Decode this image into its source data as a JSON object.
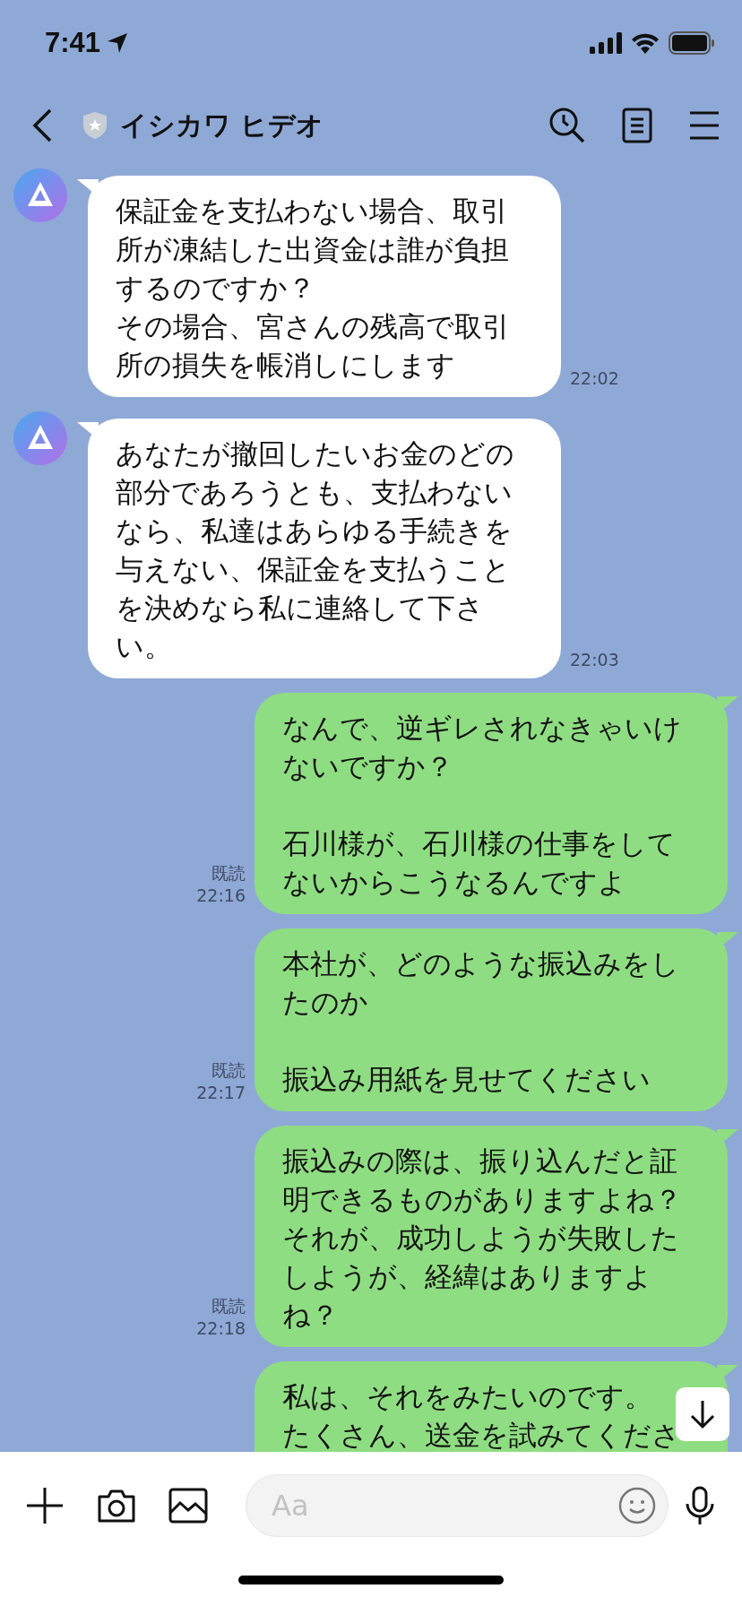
{
  "status_bar": {
    "time": "7:41"
  },
  "header": {
    "title": "イシカワ ヒデオ"
  },
  "messages": [
    {
      "kind": "incoming",
      "paragraphs": [
        {
          "text": "保証金を支払わない場合、取引所が凍結した出資金は誰が負担するのですか？",
          "gap_before": false
        },
        {
          "text": "その場合、宮さんの残高で取引所の損失を帳消しにします",
          "gap_before": false
        }
      ],
      "time": "22:02"
    },
    {
      "kind": "incoming",
      "paragraphs": [
        {
          "text": "あなたが撤回したいお金のどの部分であろうとも、支払わないなら、私達はあらゆる手続きを与えない、保証金を支払うことを決めなら私に連絡して下さい。",
          "gap_before": false
        }
      ],
      "time": "22:03"
    },
    {
      "kind": "outgoing",
      "paragraphs": [
        {
          "text": "なんで、逆ギレされなきゃいけないですか？",
          "gap_before": false
        },
        {
          "text": "石川様が、石川様の仕事をしてないからこうなるんですよ",
          "gap_before": true
        }
      ],
      "read": "既読",
      "time": "22:16"
    },
    {
      "kind": "outgoing",
      "paragraphs": [
        {
          "text": "本社が、どのような振込みをしたのか",
          "gap_before": false
        },
        {
          "text": "振込み用紙を見せてください",
          "gap_before": true
        }
      ],
      "read": "既読",
      "time": "22:17"
    },
    {
      "kind": "outgoing",
      "paragraphs": [
        {
          "text": "振込みの際は、振り込んだと証明できるものがありますよね？",
          "gap_before": false
        },
        {
          "text": "それが、成功しようが失敗したしようが、経緯はありますよね？",
          "gap_before": false
        }
      ],
      "read": "既読",
      "time": "22:18"
    },
    {
      "kind": "outgoing",
      "paragraphs": [
        {
          "text": "私は、それをみたいのです。",
          "gap_before": false
        },
        {
          "text": "たくさん、送金を試みてくださ",
          "gap_before": false
        }
      ]
    }
  ],
  "input": {
    "placeholder": "Aa"
  }
}
